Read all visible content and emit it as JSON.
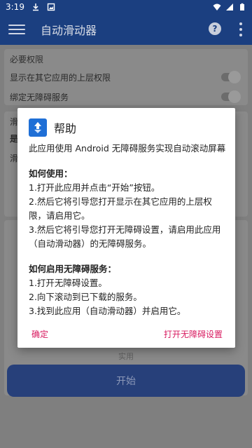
{
  "status_bar": {
    "time": "3:19",
    "icons": [
      "download-icon",
      "photo-icon",
      "wifi-icon",
      "signal-icon",
      "battery-icon"
    ]
  },
  "app_bar": {
    "title": "自动滑动器",
    "help_glyph": "?"
  },
  "background": {
    "permissions_card": {
      "title": "必要权限",
      "rows": [
        "显示在其它应用的上层权限",
        "绑定无障碍服务"
      ]
    },
    "settings_card": {
      "partial_labels": [
        "滑",
        "是",
        "滑"
      ]
    },
    "faint_label": "实用",
    "start_button": "开始"
  },
  "dialog": {
    "title": "帮助",
    "intro": "此应用使用 Android 无障碍服务实现自动滚动屏幕",
    "how_to_title": "如何使用：",
    "how_to_steps": [
      "1.打开此应用并点击“开始”按钮。",
      "2.然后它将引导您打开显示在其它应用的上层权限，请启用它。",
      "3.然后它将引导您打开无障碍设置，请启用此应用（自动滑动器）的无障碍服务。"
    ],
    "enable_title": "如何启用无障碍服务：",
    "enable_steps": [
      "1.打开无障碍设置。",
      "2.向下滚动到已下载的服务。",
      "3.找到此应用（自动滑动器）并启用它。"
    ],
    "confirm_label": "确定",
    "open_settings_label": "打开无障碍设置"
  },
  "colors": {
    "app_bar": "#1b3f80",
    "accent": "#d81b60",
    "logo": "#1f6fd6"
  }
}
